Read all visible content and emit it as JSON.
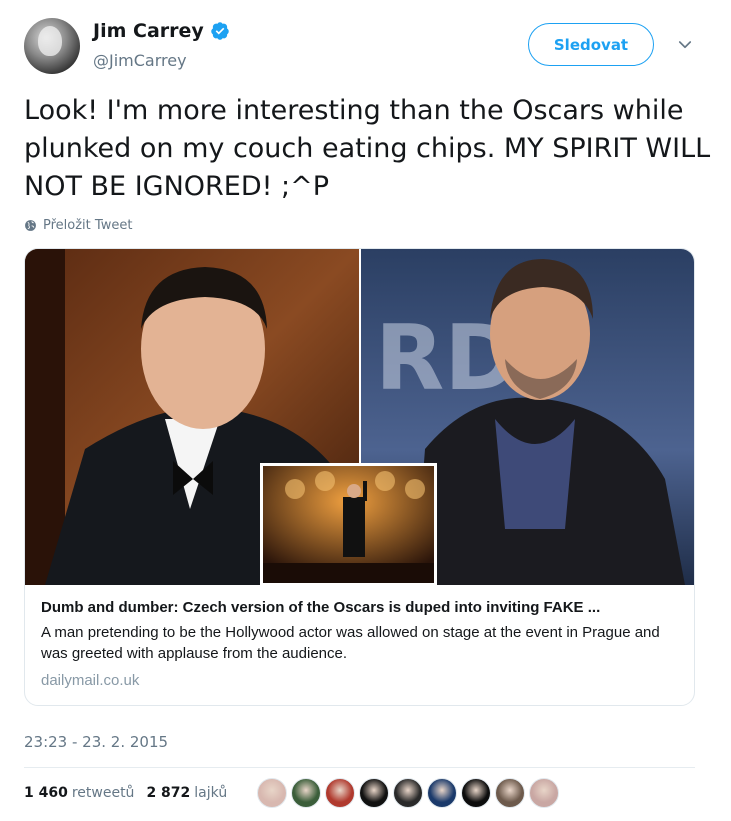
{
  "author": {
    "name": "Jim Carrey",
    "handle": "@JimCarrey",
    "avatar_icon": "profile-photo",
    "verified_icon": "verified-badge-icon"
  },
  "header": {
    "follow_label": "Sledovat",
    "caret_icon": "chevron-down-icon"
  },
  "tweet": {
    "text": "Look! I'm more interesting than the Oscars while plunked on my couch eating chips. MY SPIRIT WILL NOT BE IGNORED! ;^P",
    "translate_label": "Přeložit Tweet",
    "translate_icon": "globe-icon",
    "timestamp": "23:23 - 23. 2. 2015"
  },
  "card": {
    "title": "Dumb and dumber: Czech version of the Oscars is duped into inviting FAKE ...",
    "description": "A man pretending to be the Hollywood actor was allowed on stage at the event in Prague and was greeted with applause from the audience.",
    "domain": "dailymail.co.uk"
  },
  "stats": {
    "retweets_count": "1 460",
    "retweets_label": "retweetů",
    "likes_count": "2 872",
    "likes_label": "lajků"
  },
  "likers": [
    "#d8b8b0",
    "#3b5e3a",
    "#b03a2e",
    "#111111",
    "#2a2a2a",
    "#1b3a6b",
    "#0d0d0d",
    "#6d5a4c",
    "#c9a7a3"
  ],
  "colors": {
    "accent": "#1da1f2",
    "text": "#14171a",
    "muted": "#657786"
  }
}
